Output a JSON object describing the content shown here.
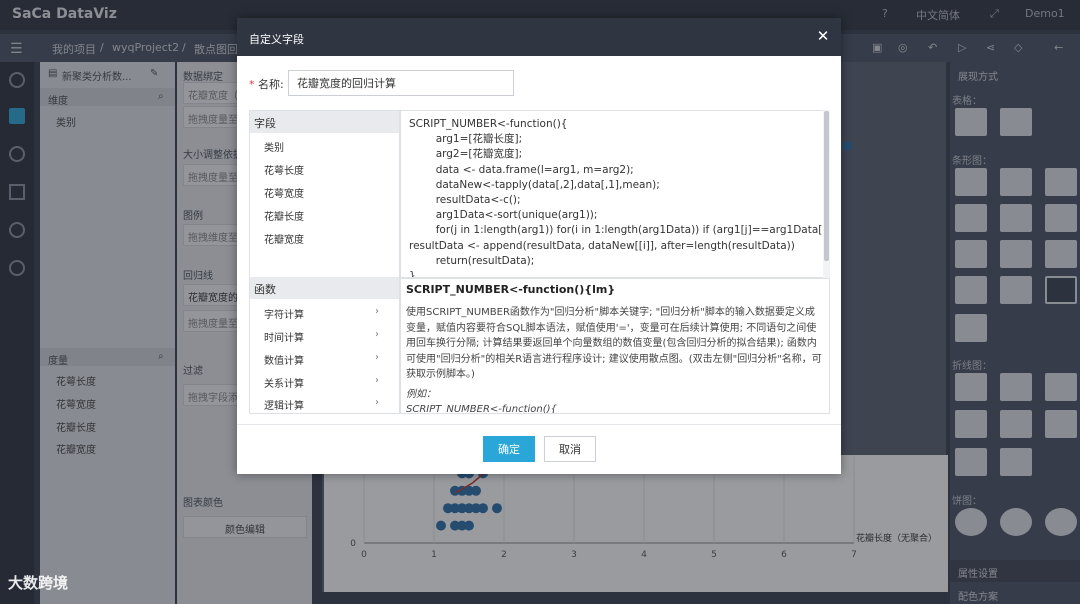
{
  "app": {
    "logo": "SaCa DataViz"
  },
  "topbar": {
    "lang": "中文简体",
    "user": "Demo1"
  },
  "toolbar": {
    "breadcrumb": [
      "我的项目",
      "wyqProject2",
      "散点图回"
    ]
  },
  "panelA": {
    "title": "新聚类分析数...",
    "dim_header": "维度",
    "dim_items": [
      "类别"
    ],
    "measure_header": "度量",
    "measure_items": [
      "花萼长度",
      "花萼宽度",
      "花瓣长度",
      "花瓣宽度"
    ]
  },
  "panelB": {
    "data_binding": "数据绑定",
    "slot1": "花瓣宽度（",
    "drop_measure": "拖拽度量至",
    "size_label": "大小调整依据",
    "legend": "图例",
    "drop_dim": "拖拽维度至",
    "regress": "回归线",
    "regress_value": "花瓣宽度的回",
    "filter": "过滤",
    "drop_field": "拖拽字段添",
    "chart_color": "图表颜色",
    "color_edit": "颜色编辑"
  },
  "rightp": {
    "title": "展现方式",
    "sec_table": "表格：",
    "sec_bar": "条形图：",
    "sec_line": "折线图：",
    "sec_pie": "饼图：",
    "prop": "属性设置",
    "scheme": "配色方案"
  },
  "chart": {
    "xlabel": "花瓣长度（无聚合）",
    "xticks": [
      "0",
      "1",
      "2",
      "3",
      "4",
      "5",
      "6",
      "7"
    ],
    "ytick0": "0"
  },
  "dialog": {
    "title": "自定义字段",
    "name_label": "名称:",
    "name_value": "花瓣宽度的回归计算",
    "fields_header": "字段",
    "fields": [
      "类别",
      "花萼长度",
      "花萼宽度",
      "花瓣长度",
      "花瓣宽度"
    ],
    "func_header": "函数",
    "funcs": [
      "字符计算",
      "时间计算",
      "数值计算",
      "关系计算",
      "逻辑计算"
    ],
    "code": "SCRIPT_NUMBER<-function(){\n        arg1=[花瓣长度];\n        arg2=[花瓣宽度];\n        data <- data.frame(l=arg1, m=arg2);\n        dataNew<-tapply(data[,2],data[,1],mean);\n        resultData<-c();\n        arg1Data<-sort(unique(arg1));\n        for(j in 1:length(arg1)) for(i in 1:length(arg1Data)) if (arg1[j]==arg1Data[i])\nresultData <- append(resultData, dataNew[[i]], after=length(resultData))\n        return(resultData);\n}",
    "desc_title": "SCRIPT_NUMBER<-function(){lm}",
    "desc_text": "使用SCRIPT_NUMBER函数作为\"回归分析\"脚本关键字; \"回归分析\"脚本的输入数据要定义成变量，赋值内容要符合SQL脚本语法，赋值使用'='，变量可在后续计算使用; 不同语句之间使用回车换行分隔; 计算结果要返回单个向量数组的数值变量(包含回归分析的拟合结果); 函数内可使用\"回归分析\"的相关R语言进行程序设计; 建议使用散点图。(双击左侧\"回归分析\"名称，可获取示例脚本。)",
    "desc_example": "例如：\nSCRIPT_NUMBER<-function(){",
    "ok": "确定",
    "cancel": "取消"
  },
  "watermark": "大数跨境"
}
